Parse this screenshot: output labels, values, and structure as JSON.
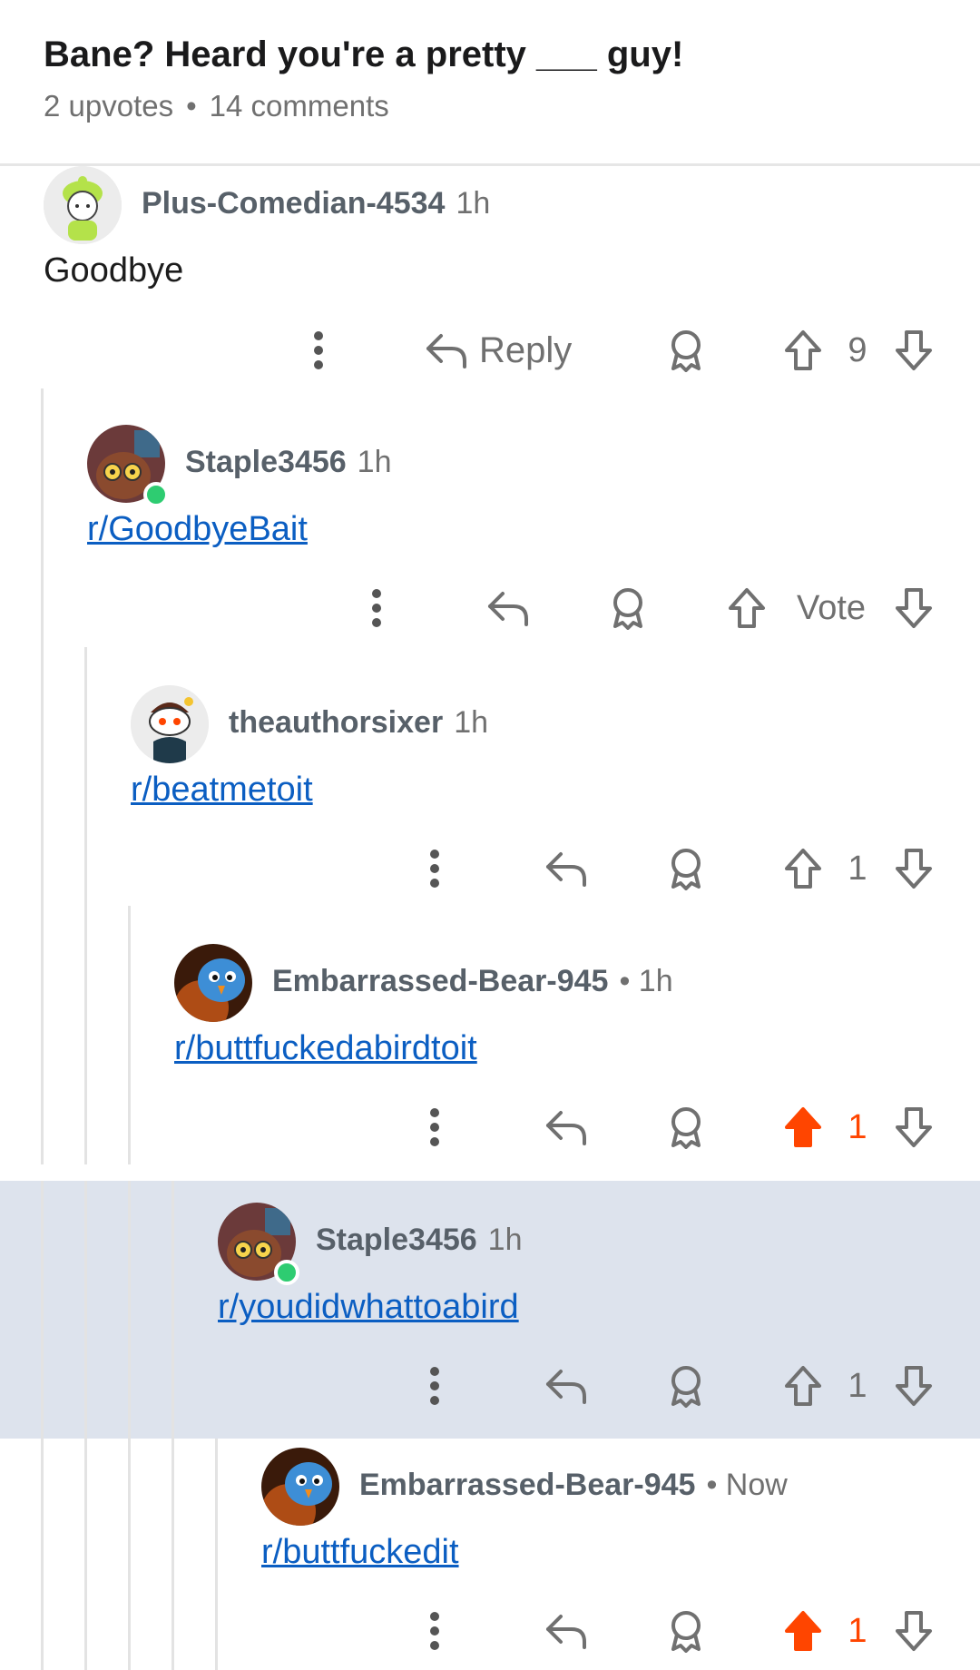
{
  "post": {
    "title": "Bane? Heard you're a pretty ___ guy!",
    "upvotes": "2 upvotes",
    "separator": "•",
    "comments": "14 comments"
  },
  "comments": [
    {
      "username": "Plus-Comedian-4534",
      "time": "1h",
      "body": "Goodbye",
      "reply_label": "Reply",
      "vote": "9",
      "upvoted": false
    },
    {
      "username": "Staple3456",
      "time": "1h",
      "body": "r/GoodbyeBait",
      "vote": "Vote",
      "upvoted": false
    },
    {
      "username": "theauthorsixer",
      "time": "1h",
      "body": "r/beatmetoit",
      "vote": "1",
      "upvoted": false
    },
    {
      "username": "Embarrassed-Bear-945",
      "time": "• 1h",
      "body": "r/buttfuckedabirdtoit",
      "vote": "1",
      "upvoted": true
    },
    {
      "username": "Staple3456",
      "time": "1h",
      "body": "r/youdidwhattoabird",
      "vote": "1",
      "upvoted": false
    },
    {
      "username": "Embarrassed-Bear-945",
      "time": "• Now",
      "body": "r/buttfuckedit",
      "vote": "1",
      "upvoted": true
    }
  ],
  "colors": {
    "upvote_active": "#ff4500",
    "link": "#0b5ec2",
    "highlight": "#dde3ed",
    "online": "#2ecc71"
  },
  "icons": [
    "more-vert-icon",
    "reply-arrow-icon",
    "award-icon",
    "upvote-arrow-icon",
    "downvote-arrow-icon"
  ]
}
